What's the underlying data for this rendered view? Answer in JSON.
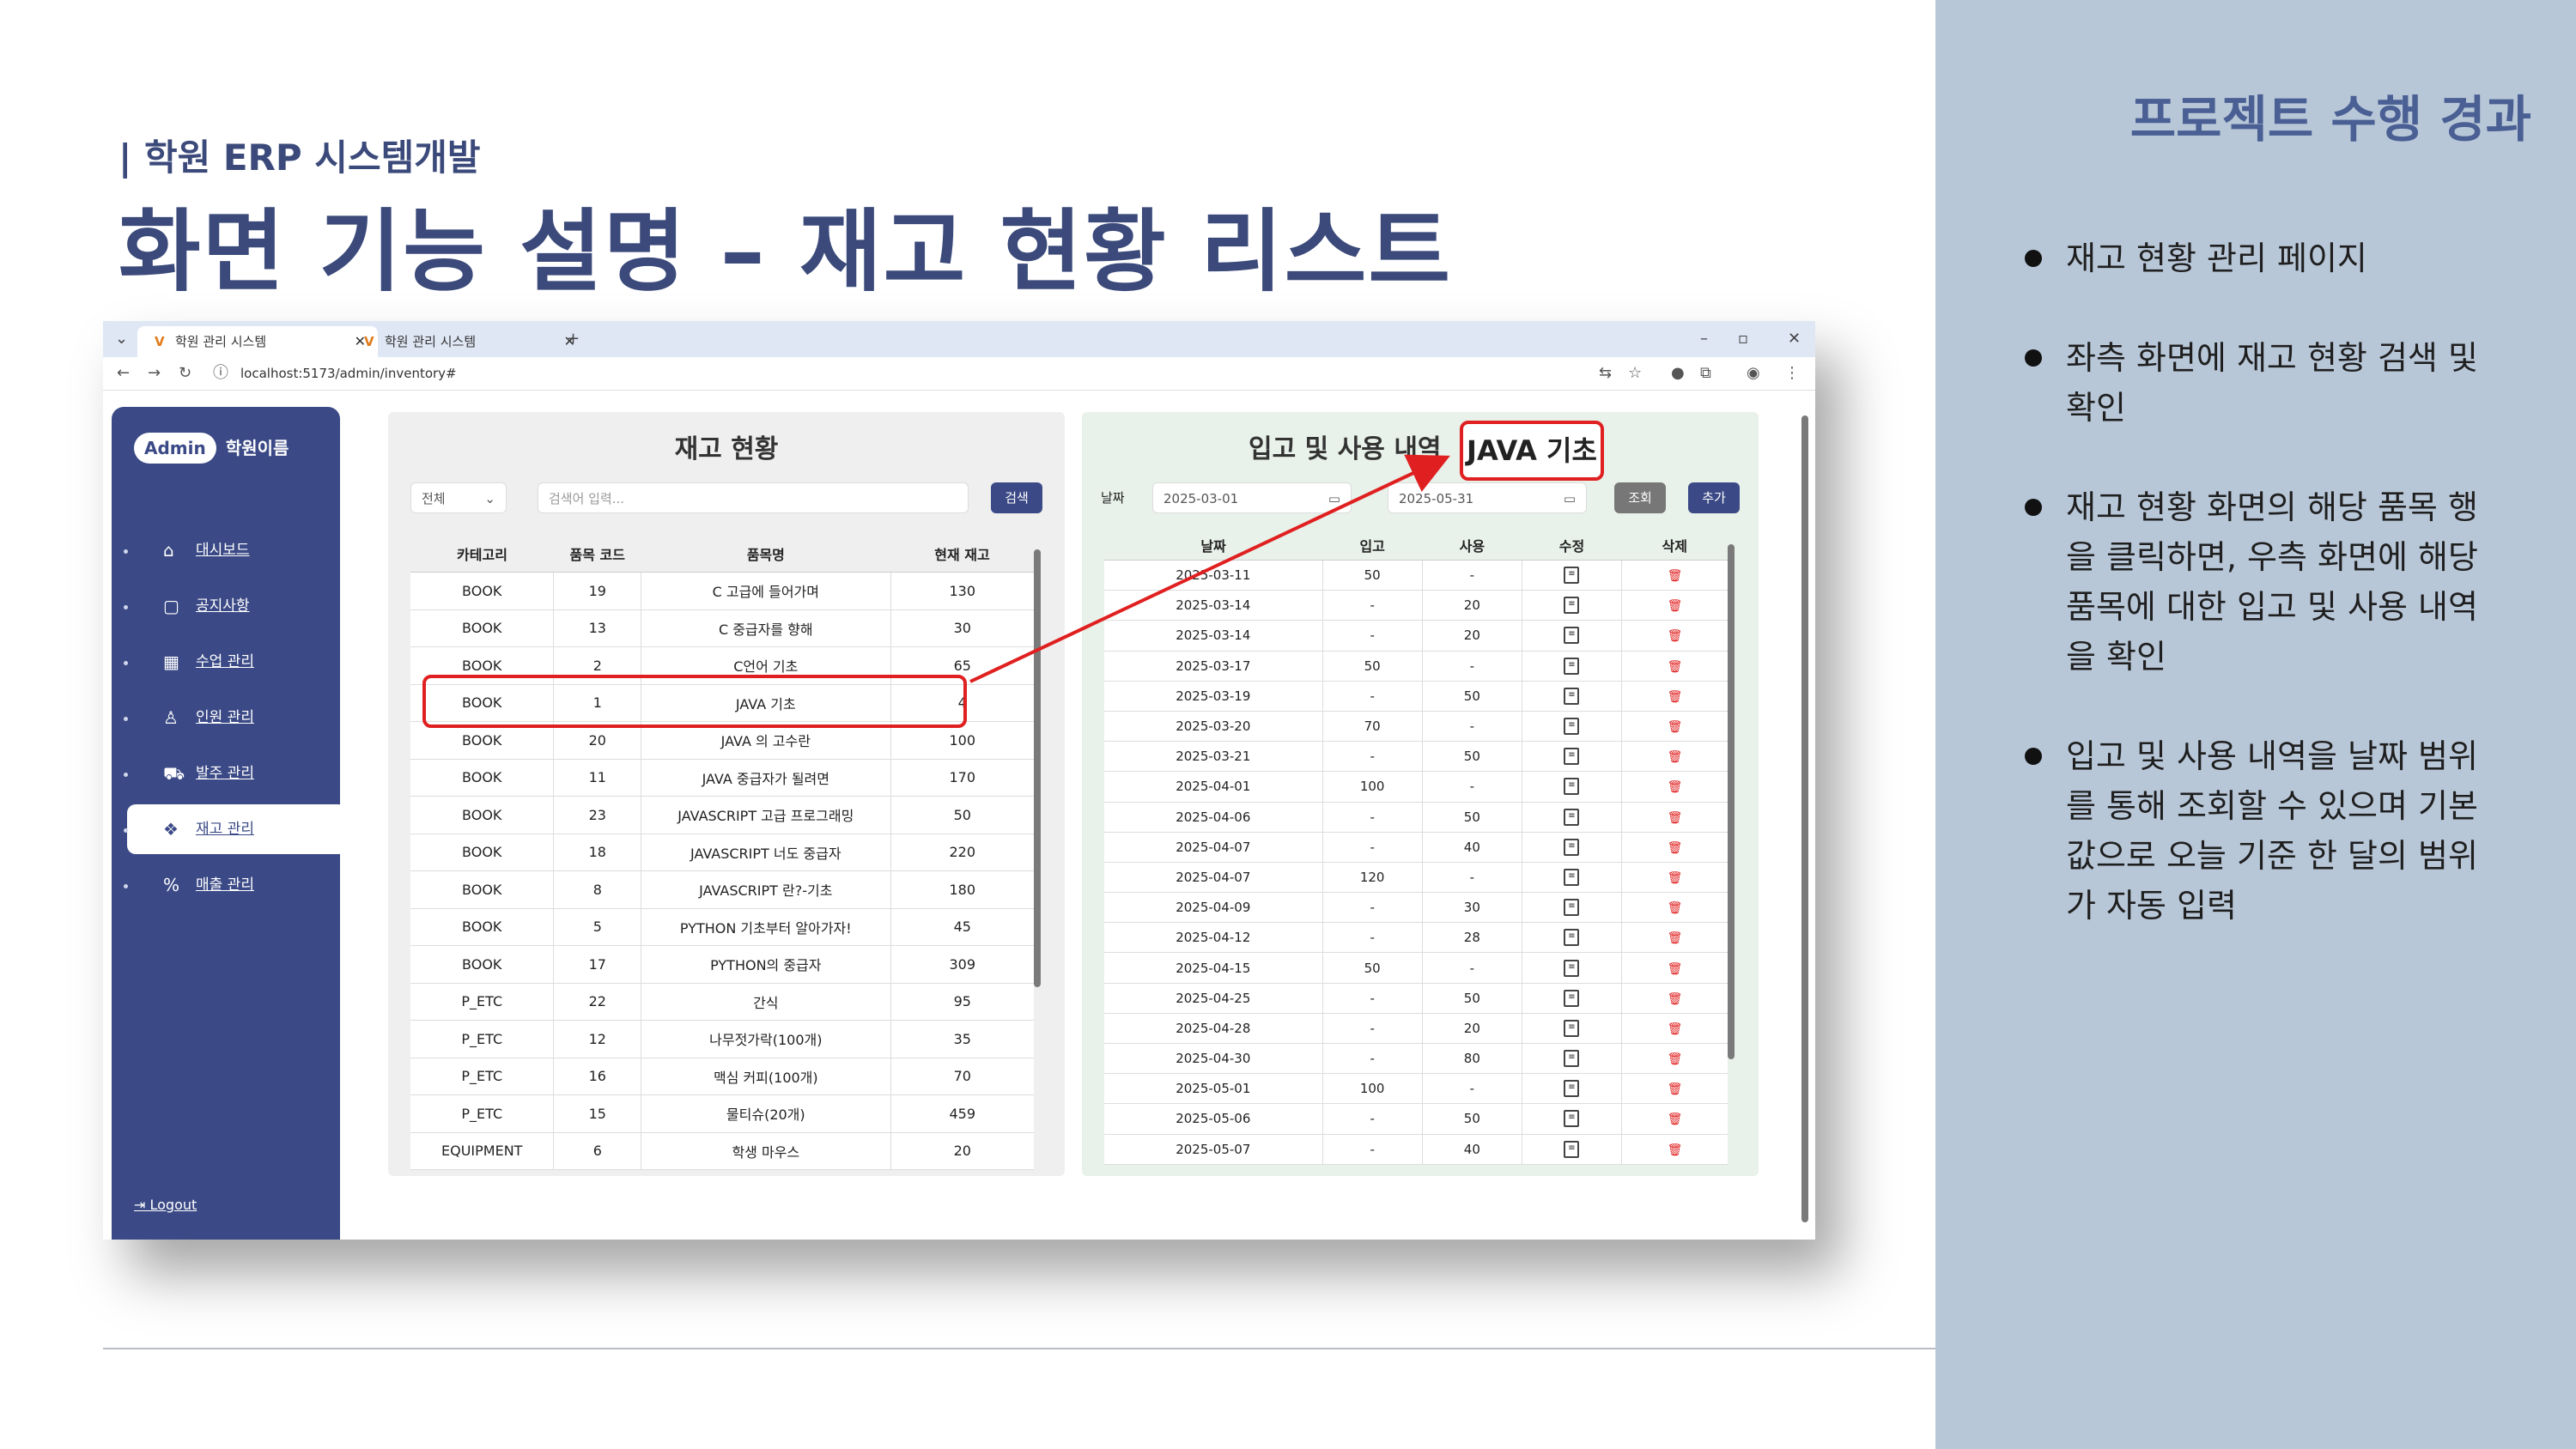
{
  "slide": {
    "subtitle": "| 학원 ERP 시스템개발",
    "title": "화면 기능 설명 – 재고 현황 리스트"
  },
  "right_panel": {
    "heading": "프로젝트 수행 경과",
    "bullets": [
      "재고 현황 관리 페이지",
      "좌측 화면에 재고 현황 검색 및 확인",
      "재고 현황 화면의 해당 품목 행을 클릭하면, 우측 화면에 해당 품목에 대한 입고 및 사용 내역을 확인",
      "입고 및 사용 내역을 날짜 범위를 통해 조회할 수 있으며 기본값으로 오늘 기준 한 달의 범위가 자동 입력"
    ]
  },
  "browser": {
    "tabs": [
      "학원 관리 시스템",
      "학원 관리 시스템"
    ],
    "url": "localhost:5173/admin/inventory#"
  },
  "sidebar": {
    "badge": "Admin",
    "brand": "학원이름",
    "items": [
      {
        "label": "대시보드",
        "icon": "home-icon",
        "glyph": "⌂"
      },
      {
        "label": "공지사항",
        "icon": "document-icon",
        "glyph": "▢"
      },
      {
        "label": "수업 관리",
        "icon": "calendar-icon",
        "glyph": "▦"
      },
      {
        "label": "인원 관리",
        "icon": "person-icon",
        "glyph": "♙"
      },
      {
        "label": "발주 관리",
        "icon": "cart-icon",
        "glyph": "⛟"
      },
      {
        "label": "재고 관리",
        "icon": "boxes-icon",
        "glyph": "❖"
      },
      {
        "label": "매출 관리",
        "icon": "percent-icon",
        "glyph": "%"
      }
    ],
    "logout": "Logout"
  },
  "inventory": {
    "title": "재고 현황",
    "filter_value": "전체",
    "search_placeholder": "검색어 입력...",
    "search_button": "검색",
    "columns": [
      "카테고리",
      "품목 코드",
      "품목명",
      "현재 재고"
    ],
    "rows": [
      [
        "BOOK",
        "19",
        "C 고급에 들어가며",
        "130"
      ],
      [
        "BOOK",
        "13",
        "C 중급자를 향해",
        "30"
      ],
      [
        "BOOK",
        "2",
        "C언어 기초",
        "65"
      ],
      [
        "BOOK",
        "1",
        "JAVA 기초",
        "4"
      ],
      [
        "BOOK",
        "20",
        "JAVA 의 고수란",
        "100"
      ],
      [
        "BOOK",
        "11",
        "JAVA 중급자가 될려면",
        "170"
      ],
      [
        "BOOK",
        "23",
        "JAVASCRIPT 고급 프로그래밍",
        "50"
      ],
      [
        "BOOK",
        "18",
        "JAVASCRIPT 너도 중급자",
        "220"
      ],
      [
        "BOOK",
        "8",
        "JAVASCRIPT 란?-기초",
        "180"
      ],
      [
        "BOOK",
        "5",
        "PYTHON 기초부터 알아가자!",
        "45"
      ],
      [
        "BOOK",
        "17",
        "PYTHON의 중급자",
        "309"
      ],
      [
        "P_ETC",
        "22",
        "간식",
        "95"
      ],
      [
        "P_ETC",
        "12",
        "나무젓가락(100개)",
        "35"
      ],
      [
        "P_ETC",
        "16",
        "맥심 커피(100개)",
        "70"
      ],
      [
        "P_ETC",
        "15",
        "물티슈(20개)",
        "459"
      ],
      [
        "EQUIPMENT",
        "6",
        "학생 마우스",
        "20"
      ]
    ]
  },
  "history": {
    "title": "입고 및 사용 내역",
    "item": "JAVA 기초",
    "date_label": "날짜",
    "start_date": "2025-03-01",
    "end_date": "2025-05-31",
    "query_button": "조회",
    "add_button": "추가",
    "columns": [
      "날짜",
      "입고",
      "사용",
      "수정",
      "삭제"
    ],
    "rows": [
      [
        "2025-03-11",
        "50",
        "-"
      ],
      [
        "2025-03-14",
        "-",
        "20"
      ],
      [
        "2025-03-14",
        "-",
        "20"
      ],
      [
        "2025-03-17",
        "50",
        "-"
      ],
      [
        "2025-03-19",
        "-",
        "50"
      ],
      [
        "2025-03-20",
        "70",
        "-"
      ],
      [
        "2025-03-21",
        "-",
        "50"
      ],
      [
        "2025-04-01",
        "100",
        "-"
      ],
      [
        "2025-04-06",
        "-",
        "50"
      ],
      [
        "2025-04-07",
        "-",
        "40"
      ],
      [
        "2025-04-07",
        "120",
        "-"
      ],
      [
        "2025-04-09",
        "-",
        "30"
      ],
      [
        "2025-04-12",
        "-",
        "28"
      ],
      [
        "2025-04-15",
        "50",
        "-"
      ],
      [
        "2025-04-25",
        "-",
        "50"
      ],
      [
        "2025-04-28",
        "-",
        "20"
      ],
      [
        "2025-04-30",
        "-",
        "80"
      ],
      [
        "2025-05-01",
        "100",
        "-"
      ],
      [
        "2025-05-06",
        "-",
        "50"
      ],
      [
        "2025-05-07",
        "-",
        "40"
      ]
    ]
  },
  "colors": {
    "accent": "#3b4a86",
    "highlight": "#e02020",
    "right_panel_bg": "#b8c7d8"
  }
}
